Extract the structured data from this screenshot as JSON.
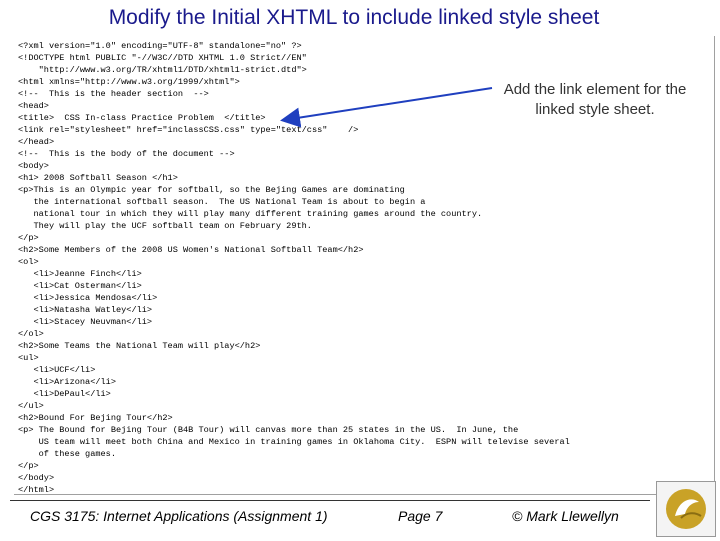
{
  "slide": {
    "title": "Modify the Initial XHTML to include linked style sheet",
    "code_lines": [
      "<?xml version=\"1.0\" encoding=\"UTF-8\" standalone=\"no\" ?>",
      "<!DOCTYPE html PUBLIC \"-//W3C//DTD XHTML 1.0 Strict//EN\"",
      "    \"http://www.w3.org/TR/xhtml1/DTD/xhtml1-strict.dtd\">",
      "<html xmlns=\"http://www.w3.org/1999/xhtml\">",
      "<!--  This is the header section  -->",
      "<head>",
      "<title>  CSS In-class Practice Problem  </title>",
      "<link rel=\"stylesheet\" href=\"inclassCSS.css\" type=\"text/css\"    />",
      "</head>",
      "<!--  This is the body of the document -->",
      "<body>",
      "<h1> 2008 Softball Season </h1>",
      "<p>This is an Olympic year for softball, so the Bejing Games are dominating",
      "   the international softball season.  The US National Team is about to begin a",
      "   national tour in which they will play many different training games around the country.",
      "   They will play the UCF softball team on February 29th.",
      "</p>",
      "<h2>Some Members of the 2008 US Women's National Softball Team</h2>",
      "<ol>",
      "   <li>Jeanne Finch</li>",
      "   <li>Cat Osterman</li>",
      "   <li>Jessica Mendosa</li>",
      "   <li>Natasha Watley</li>",
      "   <li>Stacey Neuvman</li>",
      "</ol>",
      "<h2>Some Teams the National Team will play</h2>",
      "<ul>",
      "   <li>UCF</li>",
      "   <li>Arizona</li>",
      "   <li>DePaul</li>",
      "</ul>",
      "<h2>Bound For Bejing Tour</h2>",
      "<p> The Bound for Bejing Tour (B4B Tour) will canvas more than 25 states in the US.  In June, the",
      "    US team will meet both China and Mexico in training games in Oklahoma City.  ESPN will televise several",
      "    of these games.",
      "</p>",
      "</body>",
      "</html>"
    ],
    "callout": "Add the link element for the linked style sheet.",
    "footer": {
      "course": "CGS 3175: Internet Applications (Assignment 1)",
      "page": "Page 7",
      "author": "© Mark Llewellyn"
    }
  }
}
